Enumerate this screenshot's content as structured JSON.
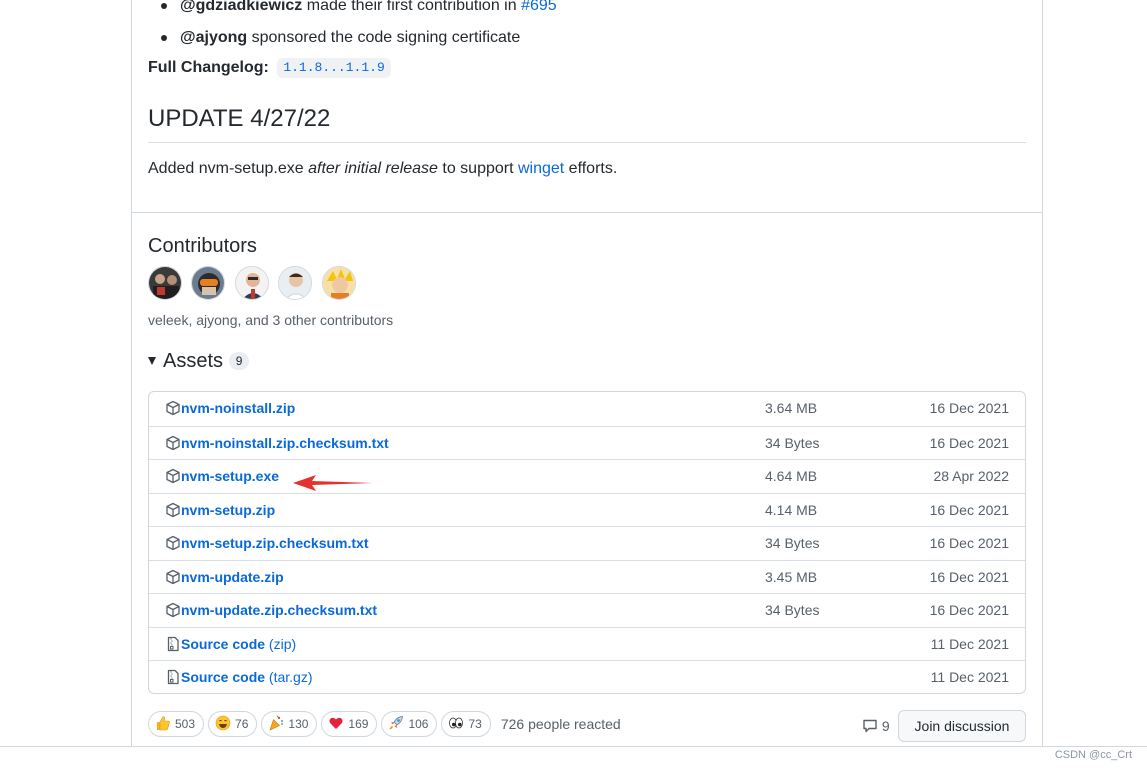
{
  "release_notes": {
    "bullets": [
      {
        "user": "@gdziadkiewicz",
        "text": "made their first contribution in",
        "link": "#695"
      },
      {
        "user": "@ajyong",
        "text": "sponsored the code signing certificate"
      }
    ],
    "changelog_label": "Full Changelog:",
    "changelog_link": "1.1.8...1.1.9",
    "update_heading": "UPDATE 4/27/22",
    "update_text_1": "Added nvm-setup.exe ",
    "update_text_em": "after initial release",
    "update_text_2": " to support ",
    "update_link": "winget",
    "update_text_3": " efforts."
  },
  "contributors": {
    "heading": "Contributors",
    "summary": "veleek, ajyong, and 3 other contributors"
  },
  "assets": {
    "heading": "Assets",
    "count": "9",
    "rows": [
      {
        "name": "nvm-noinstall.zip",
        "size": "3.64 MB",
        "date": "16 Dec 2021",
        "icon": "package-icon"
      },
      {
        "name": "nvm-noinstall.zip.checksum.txt",
        "size": "34 Bytes",
        "date": "16 Dec 2021",
        "icon": "package-icon"
      },
      {
        "name": "nvm-setup.exe",
        "size": "4.64 MB",
        "date": "28 Apr 2022",
        "icon": "package-icon"
      },
      {
        "name": "nvm-setup.zip",
        "size": "4.14 MB",
        "date": "16 Dec 2021",
        "icon": "package-icon"
      },
      {
        "name": "nvm-setup.zip.checksum.txt",
        "size": "34 Bytes",
        "date": "16 Dec 2021",
        "icon": "package-icon"
      },
      {
        "name": "nvm-update.zip",
        "size": "3.45 MB",
        "date": "16 Dec 2021",
        "icon": "package-icon"
      },
      {
        "name": "nvm-update.zip.checksum.txt",
        "size": "34 Bytes",
        "date": "16 Dec 2021",
        "icon": "package-icon"
      },
      {
        "name": "Source code",
        "suffix": "(zip)",
        "size": "",
        "date": "11 Dec 2021",
        "icon": "file-zip-icon"
      },
      {
        "name": "Source code",
        "suffix": "(tar.gz)",
        "size": "",
        "date": "11 Dec 2021",
        "icon": "file-zip-icon"
      }
    ]
  },
  "reactions": {
    "items": [
      {
        "emoji": "thumbs-up",
        "count": "503"
      },
      {
        "emoji": "laugh",
        "count": "76"
      },
      {
        "emoji": "hooray",
        "count": "130"
      },
      {
        "emoji": "heart",
        "count": "169"
      },
      {
        "emoji": "rocket",
        "count": "106"
      },
      {
        "emoji": "eyes",
        "count": "73"
      }
    ],
    "summary": "726 people reacted"
  },
  "discussion": {
    "comment_count": "9",
    "join_label": "Join discussion"
  },
  "watermark": "CSDN @cc_Crt",
  "colors": {
    "link": "#0969da",
    "arrow": "#e5322e",
    "border": "#d0d7de"
  }
}
